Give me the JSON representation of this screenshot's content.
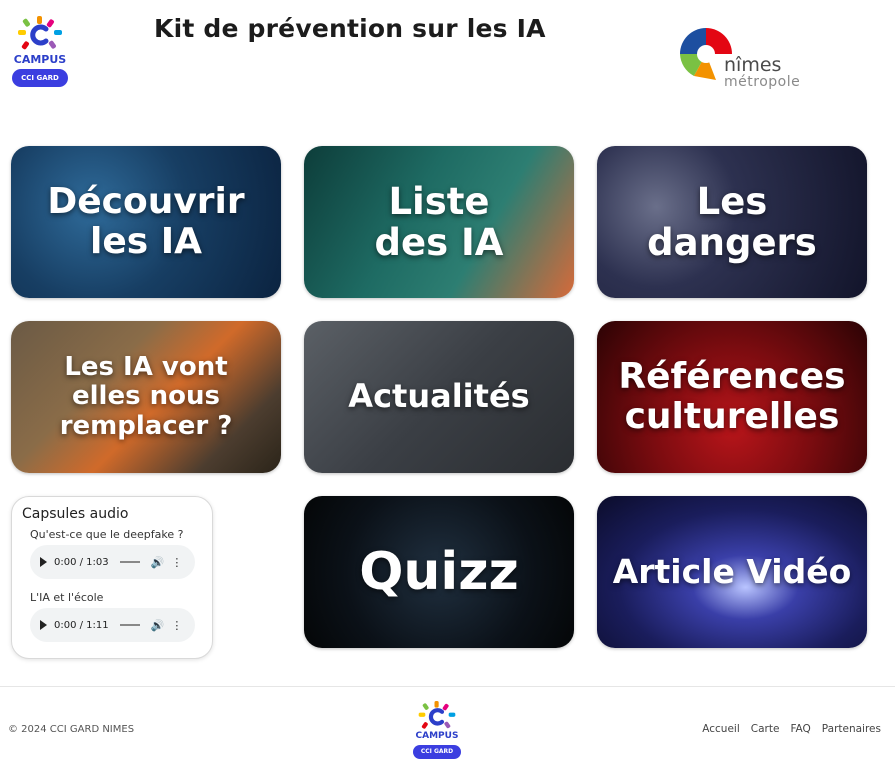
{
  "header": {
    "title": "Kit de prévention sur les IA",
    "campus_logo": {
      "word": "CAMPUS",
      "badge": "CCI GARD"
    },
    "nimes_logo": {
      "line1": "nîmes",
      "line2": "métropole"
    }
  },
  "cards": [
    {
      "label": "Découvrir\nles IA"
    },
    {
      "label": "Liste\ndes IA"
    },
    {
      "label": "Les\ndangers"
    },
    {
      "label": "Les IA vont\nelles nous\nremplacer ?"
    },
    {
      "label": "Actualités"
    },
    {
      "label": "Références\nculturelles"
    },
    {
      "label": "Quizz"
    },
    {
      "label": "Article Vidéo"
    }
  ],
  "audio": {
    "title": "Capsules audio",
    "items": [
      {
        "label": "Qu'est-ce que le deepfake ?",
        "time": "0:00 / 1:03"
      },
      {
        "label": "L'IA et l'école",
        "time": "0:00 / 1:11"
      }
    ]
  },
  "footer": {
    "copyright": "© 2024 CCI GARD NIMES",
    "campus_logo": {
      "word": "CAMPUS",
      "badge": "CCI GARD"
    },
    "nav": [
      "Accueil",
      "Carte",
      "FAQ",
      "Partenaires"
    ]
  },
  "icons": {
    "campus_logo": "campus-logo-icon",
    "nimes_logo": "nimes-metropole-logo-icon",
    "play": "play-icon",
    "volume": "volume-icon",
    "more": "more-vertical-icon"
  },
  "colors": {
    "campus_blue": "#2c3fc9",
    "badge_blue": "#3b3ee0",
    "player_bg": "#f1f3f4"
  }
}
